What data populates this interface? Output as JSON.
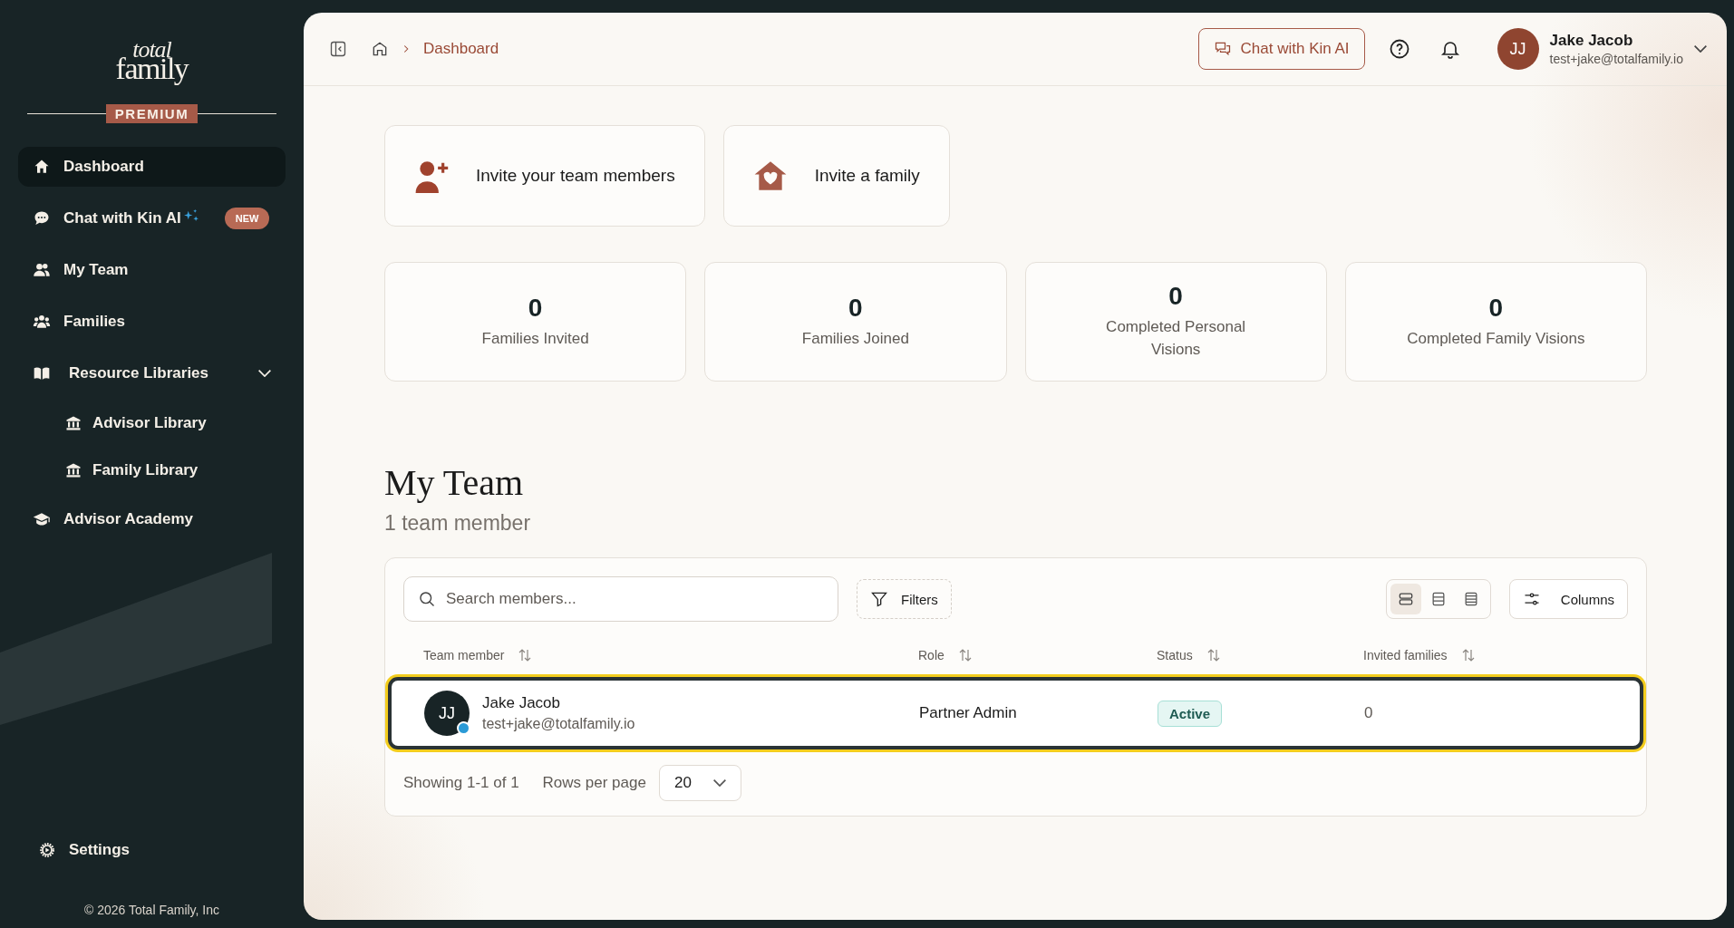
{
  "sidebar": {
    "logo": {
      "line1": "total",
      "line2": "family"
    },
    "plan_badge": "PREMIUM",
    "items": [
      {
        "kind": "link",
        "label": "Dashboard",
        "selected": true
      },
      {
        "kind": "link",
        "label": "Chat with Kin AI",
        "selected": false,
        "sparkle": true,
        "badge": "NEW"
      },
      {
        "kind": "link",
        "label": "My Team",
        "selected": false
      },
      {
        "kind": "link",
        "label": "Families",
        "selected": false
      },
      {
        "kind": "group",
        "label": "Resource Libraries",
        "selected": false,
        "expanded": true,
        "children": [
          {
            "label": "Advisor Library",
            "selected": false
          },
          {
            "label": "Family Library",
            "selected": false
          }
        ]
      },
      {
        "kind": "link",
        "label": "Advisor Academy",
        "selected": false
      }
    ],
    "settings": "Settings",
    "copyright": "© 2026 Total Family, Inc"
  },
  "header": {
    "breadcrumb": [
      "Dashboard"
    ],
    "chat_button": "Chat with Kin AI",
    "user": {
      "initials": "JJ",
      "name": "Jake Jacob",
      "email": "test+jake@totalfamily.io"
    }
  },
  "actions": [
    {
      "label": "Invite your team members"
    },
    {
      "label": "Invite a family"
    }
  ],
  "stats": [
    {
      "value": "0",
      "label": "Families Invited"
    },
    {
      "value": "0",
      "label": "Families Joined"
    },
    {
      "value": "0",
      "label": "Completed Personal Visions"
    },
    {
      "value": "0",
      "label": "Completed Family Visions"
    }
  ],
  "team": {
    "title": "My Team",
    "subtitle": "1 team member",
    "search": {
      "placeholder": "Search members..."
    },
    "filters": "Filters",
    "views": [
      {
        "selected": true
      },
      {
        "selected": false
      },
      {
        "selected": false
      }
    ],
    "columns_button": "Columns",
    "table": {
      "columns": [
        "Team member",
        "Role",
        "Status",
        "Invited families"
      ],
      "rows": [
        {
          "initials": "JJ",
          "online": true,
          "name": "Jake Jacob",
          "email": "test+jake@totalfamily.io",
          "role": "Partner Admin",
          "status": "Active",
          "invited_families": "0",
          "selected": true
        }
      ]
    },
    "pagination": {
      "showing": "Showing 1-1 of 1",
      "rows_label": "Rows per page",
      "rows_value": "20"
    }
  }
}
